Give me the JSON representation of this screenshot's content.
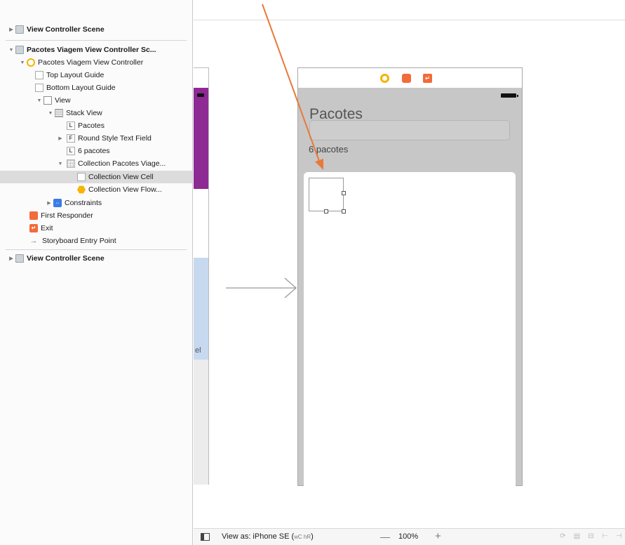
{
  "outline": {
    "items": [
      {
        "label": "View Controller Scene",
        "icon": "scene-icon",
        "disclosure": "right",
        "bold": true
      },
      {
        "label": "Pacotes Viagem View Controller Sc...",
        "icon": "scene-icon",
        "disclosure": "down",
        "bold": true
      },
      {
        "label": "Pacotes Viagem View Controller",
        "icon": "view-controller-icon",
        "disclosure": "down"
      },
      {
        "label": "Top Layout Guide",
        "icon": "layout-guide-icon"
      },
      {
        "label": "Bottom Layout Guide",
        "icon": "layout-guide-icon"
      },
      {
        "label": "View",
        "icon": "view-icon",
        "disclosure": "down"
      },
      {
        "label": "Stack View",
        "icon": "stack-view-icon",
        "disclosure": "down"
      },
      {
        "label": "Pacotes",
        "icon": "label-icon",
        "glyph": "L"
      },
      {
        "label": "Round Style Text Field",
        "icon": "text-field-icon",
        "glyph": "F",
        "disclosure": "right"
      },
      {
        "label": "6 pacotes",
        "icon": "label-icon",
        "glyph": "L"
      },
      {
        "label": "Collection Pacotes Viage...",
        "icon": "collection-view-icon",
        "disclosure": "down"
      },
      {
        "label": "Collection View Cell",
        "icon": "collection-cell-icon",
        "selected": true
      },
      {
        "label": "Collection View Flow...",
        "icon": "flow-layout-icon"
      },
      {
        "label": "Constraints",
        "icon": "constraints-icon",
        "disclosure": "right"
      },
      {
        "label": "First Responder",
        "icon": "first-responder-icon"
      },
      {
        "label": "Exit",
        "icon": "exit-icon"
      },
      {
        "label": "Storyboard Entry Point",
        "icon": "entry-point-arrow-icon"
      },
      {
        "label": "View Controller Scene",
        "icon": "scene-icon",
        "disclosure": "right",
        "bold": true
      }
    ]
  },
  "canvas": {
    "title_label": "Pacotes",
    "count_label": "6 pacotes",
    "partial_label": "el"
  },
  "bottombar": {
    "view_as": "View as: iPhone SE (",
    "view_as_size": "wC hR",
    "view_as_close": ")",
    "zoom_out": "—",
    "zoom": "100%",
    "zoom_in": "+"
  },
  "colors": {
    "accent_orange": "#f26b3a",
    "vc_yellow": "#f4b400",
    "annotation_arrow": "#e8793a",
    "purple_view": "#8e2a93",
    "selection": "#dcdcdc"
  }
}
